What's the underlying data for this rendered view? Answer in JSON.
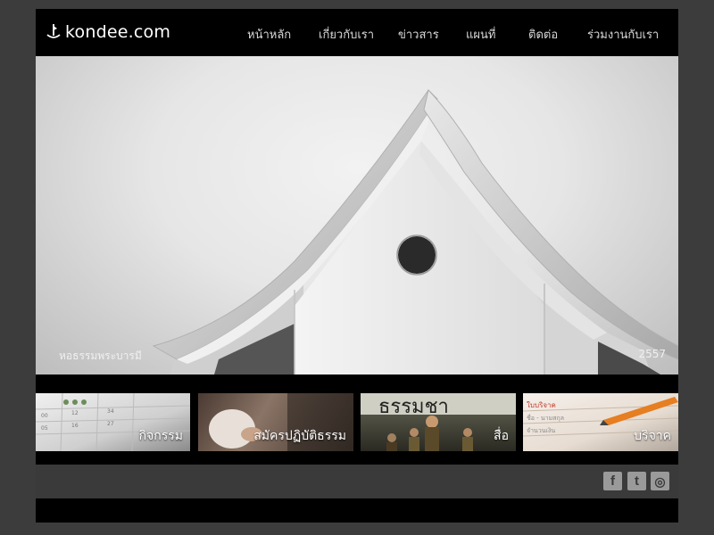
{
  "brand": {
    "name": "kondee.com",
    "icon": "boat-icon"
  },
  "nav": {
    "items": [
      {
        "label": "หน้าหลัก"
      },
      {
        "label": "เกี่ยวกับเรา"
      },
      {
        "label": "ข่าวสาร"
      },
      {
        "label": "แผนที่"
      },
      {
        "label": "ติดต่อ"
      },
      {
        "label": "ร่วมงานกับเรา"
      }
    ]
  },
  "hero": {
    "caption": "หอธรรมพระบารมี",
    "year": "2557",
    "image": "temple-gable-photo"
  },
  "tiles": [
    {
      "label": "กิจกรรม",
      "image": "calendar-photo"
    },
    {
      "label": "สมัครปฏิบัติธรรม",
      "image": "monk-hands-photo"
    },
    {
      "label": "สื่อ",
      "image": "media-poster-photo"
    },
    {
      "label": "บริจาค",
      "image": "donation-form-photo"
    }
  ],
  "social": [
    {
      "name": "facebook-icon",
      "glyph": "f"
    },
    {
      "name": "twitter-icon",
      "glyph": "t"
    },
    {
      "name": "instagram-icon",
      "glyph": "◎"
    }
  ],
  "colors": {
    "page_bg": "#3c3c3c",
    "header_bg": "#000000",
    "nav_text": "#d8d8d8",
    "footer_bg": "#3a3a3a",
    "social_icon": "#9a9a9a"
  }
}
